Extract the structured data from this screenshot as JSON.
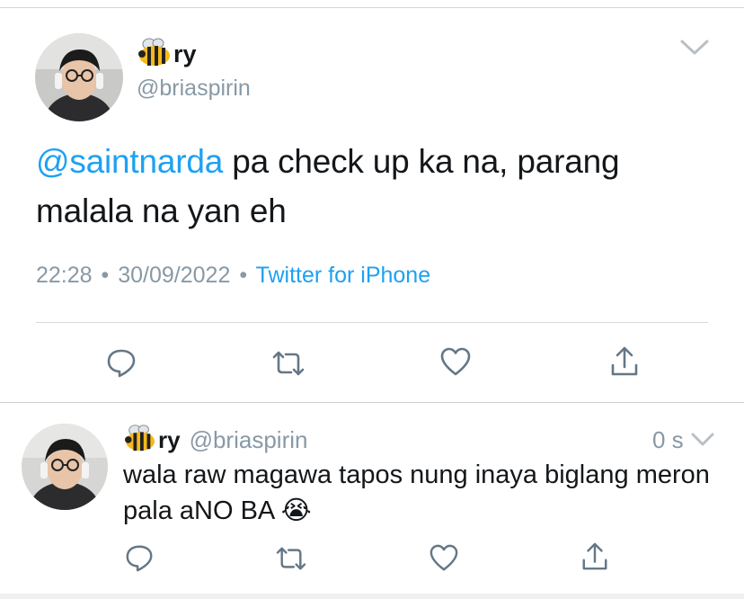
{
  "tweet": {
    "name": "ry",
    "handle": "@briaspirin",
    "mention": "@saintnarda",
    "text": " pa check up ka na, parang malala na yan eh",
    "time": "22:28",
    "date": "30/09/2022",
    "separator": "•",
    "source": "Twitter for iPhone"
  },
  "reply": {
    "name": "ry",
    "handle": "@briaspirin",
    "age": "0 s",
    "text": "wala raw magawa tapos nung inaya biglang meron pala aNO BA",
    "emoji": "😭"
  },
  "icons": {
    "reply": "reply-icon",
    "retweet": "retweet-icon",
    "like": "heart-icon",
    "share": "share-icon",
    "menu": "chevron-down-icon",
    "emoji_prefix": "bee"
  },
  "colors": {
    "accent": "#1da1f2",
    "muted": "#8899a6",
    "icon": "#657786"
  }
}
